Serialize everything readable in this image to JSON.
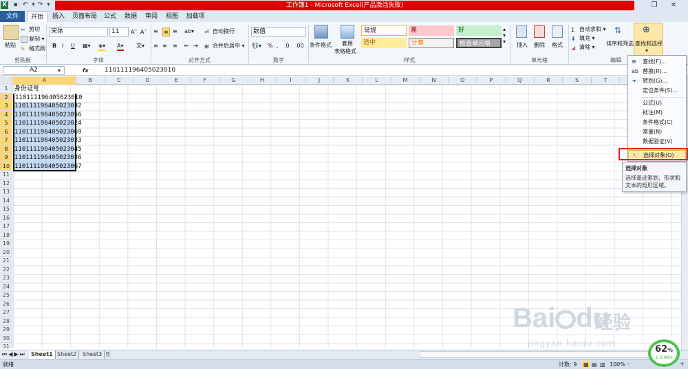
{
  "window": {
    "title": "工作簿1 - Microsoft Excel(产品激活失败)",
    "restore_icon": "restore-icon",
    "close_icon": "close-icon"
  },
  "tabs": [
    {
      "label": "文件"
    },
    {
      "label": "开始"
    },
    {
      "label": "插入"
    },
    {
      "label": "页面布局"
    },
    {
      "label": "公式"
    },
    {
      "label": "数据"
    },
    {
      "label": "审阅"
    },
    {
      "label": "视图"
    },
    {
      "label": "加载项"
    }
  ],
  "ribbon": {
    "clipboard": {
      "paste": "粘贴",
      "cut": "剪切",
      "copy": "复制",
      "format_painter": "格式刷",
      "group": "剪贴板"
    },
    "font": {
      "name": "宋体",
      "size": "11",
      "bold": "B",
      "italic": "I",
      "underline": "U",
      "group": "字体"
    },
    "alignment": {
      "wrap": "自动换行",
      "merge": "合并后居中",
      "group": "对齐方式"
    },
    "number": {
      "format": "数值",
      "percent": "%",
      "comma": ",",
      "group": "数字"
    },
    "styles": {
      "cond_format": "条件格式",
      "table_format_1": "套用",
      "table_format_2": "表格格式",
      "normal": "常规",
      "bad": "差",
      "good": "好",
      "neutral": "适中",
      "calc": "计算",
      "check": "检查单元格",
      "group": "样式"
    },
    "cells": {
      "insert": "插入",
      "delete": "删除",
      "format": "格式",
      "group": "单元格"
    },
    "editing": {
      "autosum": "自动求和",
      "fill": "填充",
      "clear": "清除",
      "sort": "排序和筛选",
      "find": "查找和选择",
      "group": "编辑"
    }
  },
  "formula_bar": {
    "name_box": "A2",
    "fx": "fx",
    "value": "110111196405023010"
  },
  "columns": [
    "A",
    "B",
    "C",
    "D",
    "E",
    "F",
    "G",
    "H",
    "I",
    "J",
    "K",
    "L",
    "M",
    "N",
    "O",
    "P",
    "Q",
    "R",
    "S",
    "T"
  ],
  "rows": [
    "1",
    "2",
    "3",
    "4",
    "5",
    "6",
    "7",
    "8",
    "9",
    "10",
    "11",
    "12",
    "13",
    "14",
    "15",
    "16",
    "17",
    "18",
    "19",
    "20",
    "21",
    "22",
    "23",
    "24",
    "25",
    "26",
    "27",
    "28",
    "29",
    "30",
    "31"
  ],
  "cells_a": [
    "身份证号",
    "110111196405023010",
    "110111196405023032",
    "110111196405023056",
    "110111196405023024",
    "110111196405023069",
    "110111196405023033",
    "110111196405023045",
    "110111196405023036",
    "110111196405023067"
  ],
  "menu": {
    "items": [
      {
        "label": "查找(F)..."
      },
      {
        "label": "替换(R)..."
      },
      {
        "label": "转到(G)..."
      },
      {
        "label": "定位条件(S)..."
      },
      {
        "label": "公式(U)"
      },
      {
        "label": "批注(M)"
      },
      {
        "label": "条件格式(C)"
      },
      {
        "label": "常量(N)"
      },
      {
        "label": "数据验证(V)"
      },
      {
        "label": "选择对象(O)"
      }
    ]
  },
  "tooltip": {
    "title": "选择对象",
    "body": "选择墨迹笔划、形状和文本的矩形区域。"
  },
  "sheets": [
    "Sheet1",
    "Sheet2",
    "Sheet3"
  ],
  "status": {
    "ready": "就绪",
    "count": "计数: 9",
    "zoom": "100%",
    "minus": "-",
    "plus": "+"
  },
  "watermark": {
    "brand": "Bai",
    "brand2": "du",
    "cn": "经验",
    "url": "jingyan.baidu.com"
  },
  "net_badge": {
    "percent": "62",
    "unit": "%",
    "speed": "↓ 2.9K/s"
  },
  "colors": {
    "title_red": "#e00000",
    "file_tab": "#2a5d9e",
    "selection": "#c5d9f1",
    "highlight": "#fde9b0",
    "badge_green": "#4cc24c"
  }
}
